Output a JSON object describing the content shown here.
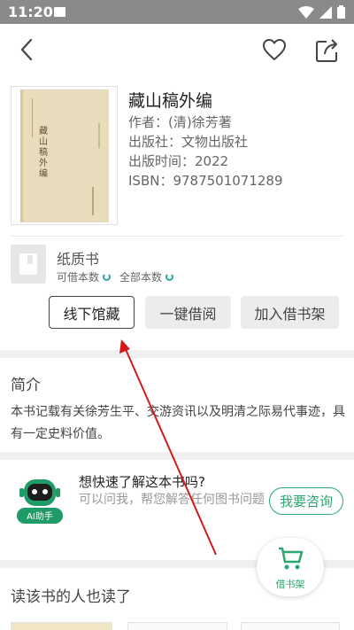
{
  "status_bar": {
    "time": "11:20"
  },
  "book": {
    "cover_text": "藏山稿外编",
    "title": "藏山稿外编",
    "author": "作者：(清)徐芳著",
    "publisher": "出版社：文物出版社",
    "publish_time": "出版时间：2022",
    "isbn": "ISBN：9787501071289"
  },
  "format": {
    "name": "纸质书",
    "available_label": "可借本数",
    "total_label": "全部本数"
  },
  "actions": {
    "offline_label": "线下馆藏",
    "borrow_label": "一键借阅",
    "add_shelf_label": "加入借书架"
  },
  "intro": {
    "title": "简介",
    "text": "本书记载有关徐芳生平、交游资讯以及明清之际易代事迹，具有一定史料价值。"
  },
  "ai": {
    "badge": "AI助手",
    "title": "想快速了解这本书吗?",
    "subtitle": "可以问我，帮您解答任何图书问题",
    "consult_label": "我要咨询"
  },
  "fab": {
    "label": "借书架"
  },
  "also_read": {
    "title": "读该书的人也读了"
  },
  "colors": {
    "accent": "#2aa86f",
    "annotation_arrow": "#d11a1a"
  }
}
